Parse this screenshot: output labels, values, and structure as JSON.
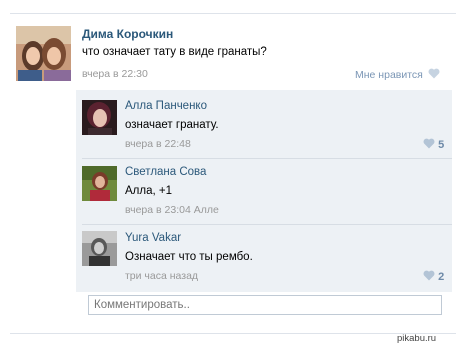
{
  "post": {
    "author": "Дима Корочкин",
    "text": "что означает тату в виде гранаты?",
    "time": "вчера в 22:30",
    "like_label": "Мне нравится"
  },
  "replies": [
    {
      "name": "Алла Панченко",
      "text": "означает гранату.",
      "time": "вчера в 22:48",
      "likes": "5"
    },
    {
      "name": "Светлана Сова",
      "text": "Алла, +1",
      "time": "вчера в 23:04 Алле",
      "likes": ""
    },
    {
      "name": "Yura Vakar",
      "text": "Означает что ты рембо.",
      "time": "три часа назад",
      "likes": "2"
    }
  ],
  "comment": {
    "placeholder": "Комментировать.."
  },
  "watermark": "pikabu.ru",
  "colors": {
    "link": "#2b587a",
    "reply_bg": "#edf1f5",
    "heart": "#c6d3e1"
  }
}
